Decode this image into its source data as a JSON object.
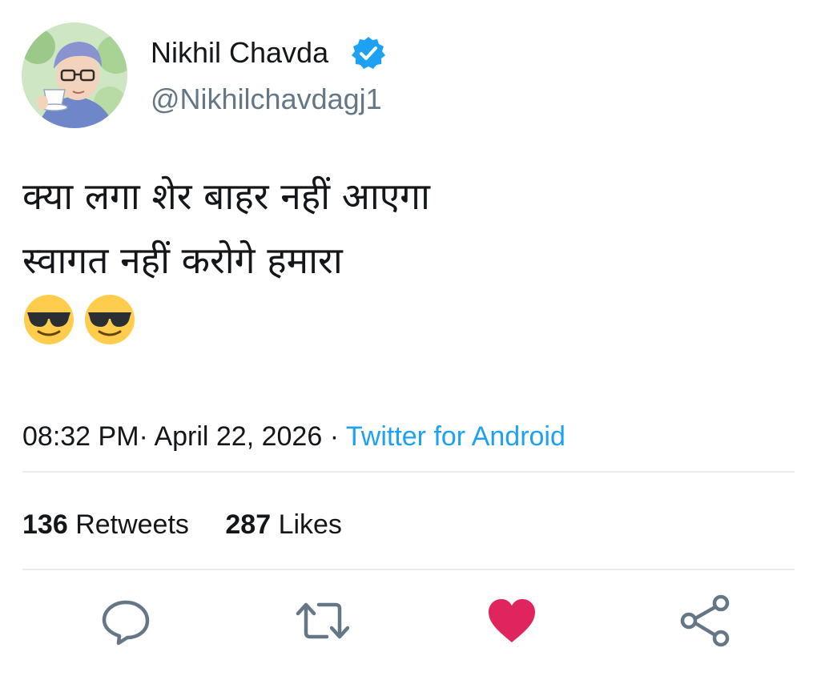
{
  "tweet": {
    "author": {
      "display_name": "Nikhil Chavda",
      "handle": "@Nikhilchavdagj1",
      "verified": true,
      "avatar": "avatar-illustration"
    },
    "text_lines": [
      "क्या लगा शेर बाहर नहीं आएगा",
      "स्वागत नहीं करोगे हमारा"
    ],
    "emojis": [
      "sunglasses-face-emoji",
      "sunglasses-face-emoji"
    ],
    "timestamp": "08:32 PM",
    "date": "April 22, 2026",
    "separator": "·",
    "source": "Twitter for Android",
    "stats": {
      "retweets_count": "136",
      "retweets_label": "Retweets",
      "likes_count": "287",
      "likes_label": "Likes"
    },
    "actions": [
      "reply-icon",
      "retweet-icon",
      "like-icon",
      "share-icon"
    ]
  },
  "colors": {
    "text": "#14171a",
    "secondary": "#657786",
    "link": "#1da1f2",
    "like": "#e0245e",
    "icon": "#657786",
    "divider": "#e6ecf0",
    "verified": "#1da1f2"
  }
}
